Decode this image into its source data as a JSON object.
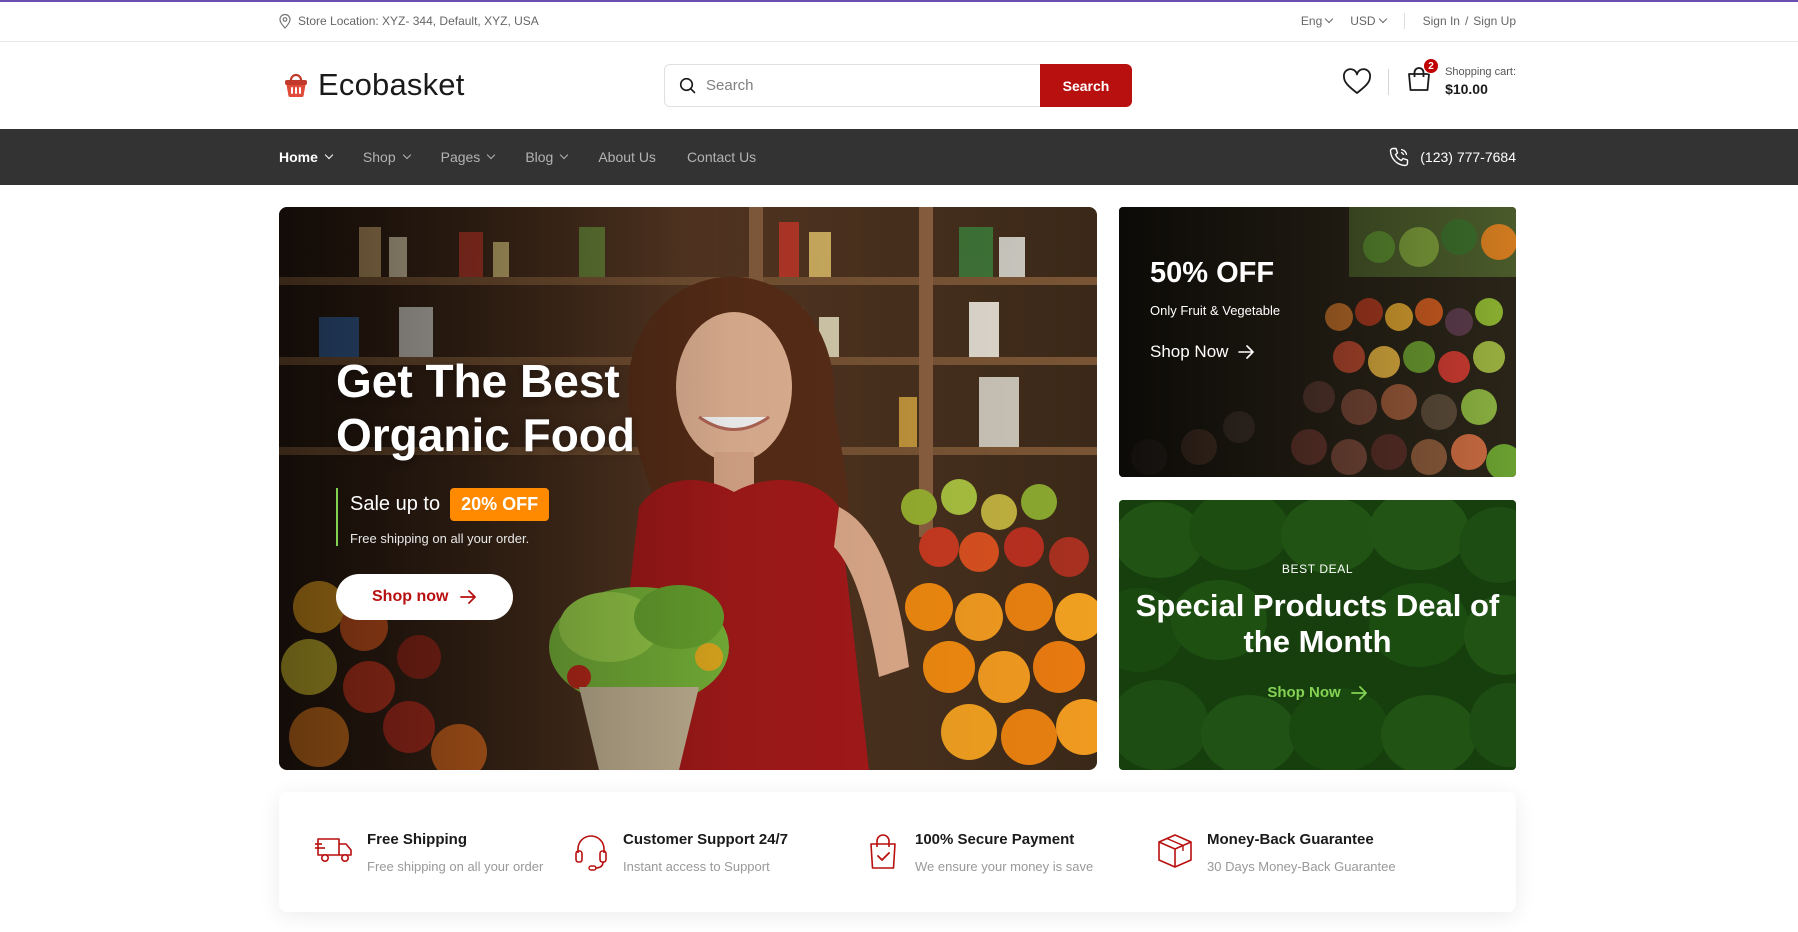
{
  "topbar": {
    "store_location": "Store Location: XYZ- 344, Default, XYZ, USA",
    "language": "Eng",
    "currency": "USD",
    "sign_in": "Sign In",
    "slash": "/",
    "sign_up": "Sign Up"
  },
  "header": {
    "logo_text": "Ecobasket",
    "search_placeholder": "Search",
    "search_button": "Search",
    "cart_count": "2",
    "cart_label": "Shopping cart:",
    "cart_amount": "$10.00"
  },
  "nav": {
    "items": [
      {
        "label": "Home",
        "dropdown": true,
        "active": true
      },
      {
        "label": "Shop",
        "dropdown": true
      },
      {
        "label": "Pages",
        "dropdown": true
      },
      {
        "label": "Blog",
        "dropdown": true
      },
      {
        "label": "About Us"
      },
      {
        "label": "Contact Us"
      }
    ],
    "phone": "(123) 777-7684"
  },
  "hero": {
    "title": "Get The Best Organic Food",
    "sale_prefix": "Sale up to",
    "sale_badge": "20% OFF",
    "sale_sub": "Free shipping on all your order.",
    "button": "Shop now"
  },
  "banner_top": {
    "title": "50% OFF",
    "subtitle": "Only Fruit & Vegetable",
    "link": "Shop Now"
  },
  "banner_bottom": {
    "kicker": "BEST DEAL",
    "title": "Special Products Deal of the Month",
    "link": "Shop Now"
  },
  "features": [
    {
      "icon": "truck-icon",
      "title": "Free Shipping",
      "desc": "Free shipping on all your order"
    },
    {
      "icon": "headset-icon",
      "title": "Customer Support 24/7",
      "desc": "Instant access to Support"
    },
    {
      "icon": "shopping-bag-check-icon",
      "title": "100% Secure Payment",
      "desc": "We ensure your money is save"
    },
    {
      "icon": "package-box-icon",
      "title": "Money-Back Guarantee",
      "desc": "30 Days Money-Back Guarantee"
    }
  ],
  "colors": {
    "brand_red": "#b80f0f",
    "nav_bg": "#333333",
    "green_accent": "#84d154",
    "orange_badge": "#ff8a00"
  }
}
